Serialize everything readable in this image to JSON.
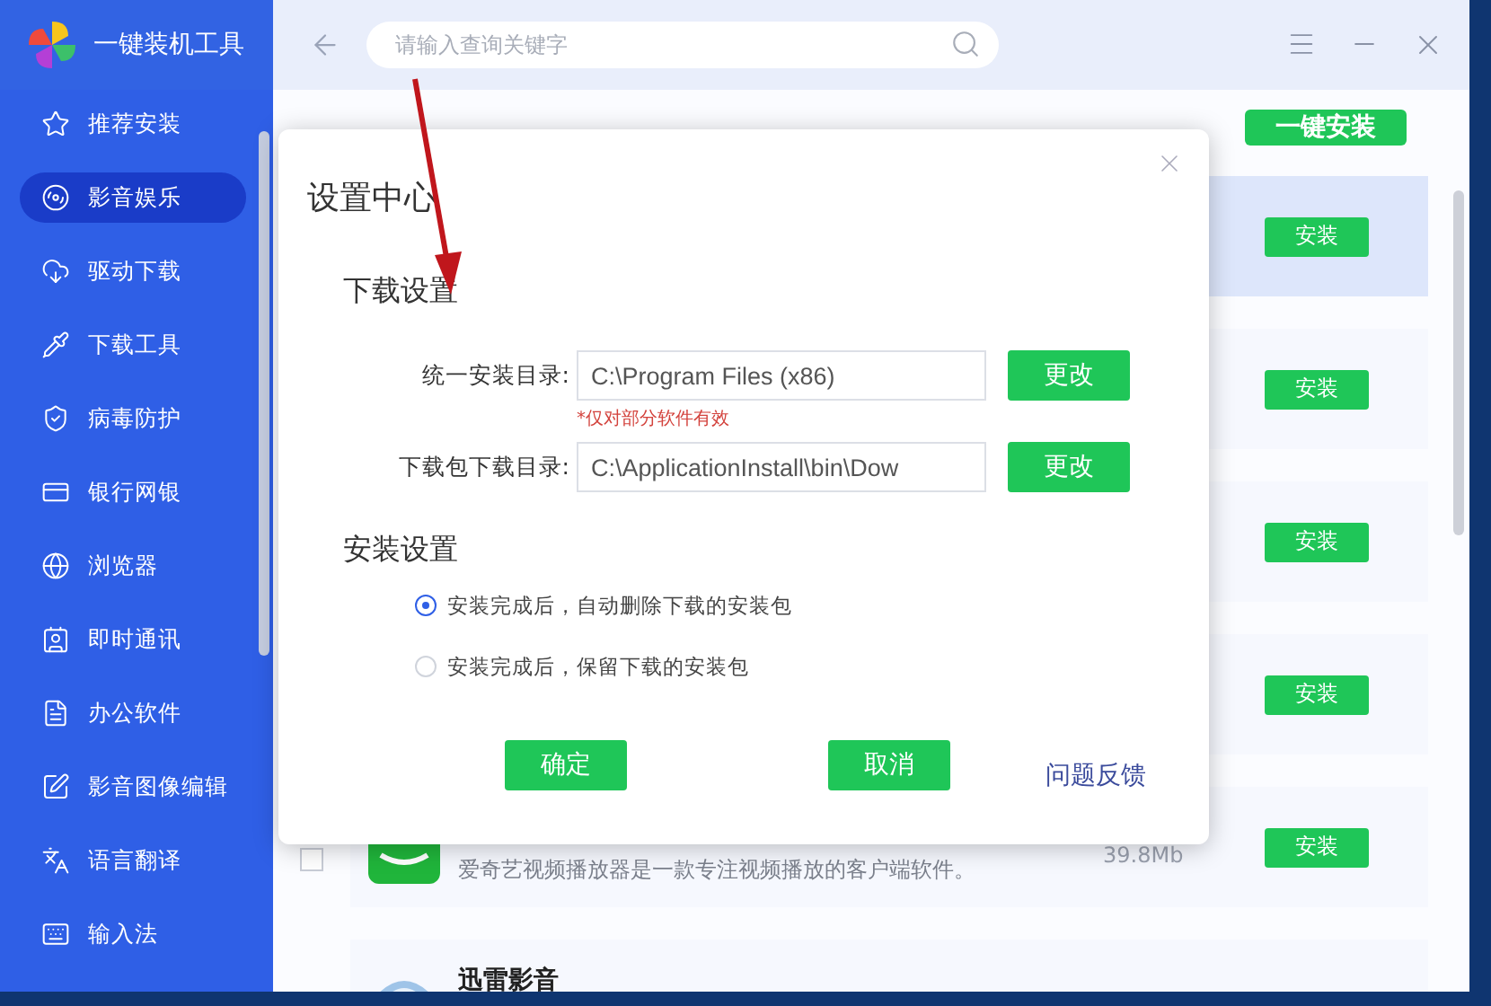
{
  "app": {
    "title": "一键装机工具"
  },
  "sidebar": {
    "items": [
      {
        "label": "推荐安装",
        "selected": false
      },
      {
        "label": "影音娱乐",
        "selected": true
      },
      {
        "label": "驱动下载",
        "selected": false
      },
      {
        "label": "下载工具",
        "selected": false
      },
      {
        "label": "病毒防护",
        "selected": false
      },
      {
        "label": "银行网银",
        "selected": false
      },
      {
        "label": "浏览器",
        "selected": false
      },
      {
        "label": "即时通讯",
        "selected": false
      },
      {
        "label": "办公软件",
        "selected": false
      },
      {
        "label": "影音图像编辑",
        "selected": false
      },
      {
        "label": "语言翻译",
        "selected": false
      },
      {
        "label": "输入法",
        "selected": false
      }
    ]
  },
  "search": {
    "placeholder": "请输入查询关键字"
  },
  "one_click_install": "一键安装",
  "apps": [
    {
      "selected": true,
      "button": "安装"
    },
    {
      "selected": false,
      "button": "安装"
    },
    {
      "selected": false,
      "button": "安装"
    },
    {
      "selected": false,
      "button": "安装"
    },
    {
      "selected": false,
      "checked": false,
      "description": "爱奇艺视频播放器是一款专注视频播放的客户端软件。",
      "size": "39.8Mb",
      "button": "安装"
    },
    {
      "selected": false,
      "title": "迅雷影音"
    }
  ],
  "dialog": {
    "title": "设置中心",
    "download_section": "下载设置",
    "fields": [
      {
        "label": "统一安装目录:",
        "value": "C:\\Program Files (x86)",
        "button": "更改",
        "note": "*仅对部分软件有效"
      },
      {
        "label": "下载包下载目录:",
        "value": "C:\\ApplicationInstall\\bin\\Dow",
        "button": "更改"
      }
    ],
    "install_section": "安装设置",
    "options": [
      {
        "label": "安装完成后，自动删除下载的安装包",
        "selected": true
      },
      {
        "label": "安装完成后，保留下载的安装包",
        "selected": false
      }
    ],
    "ok": "确定",
    "cancel": "取消",
    "feedback": "问题反馈"
  }
}
